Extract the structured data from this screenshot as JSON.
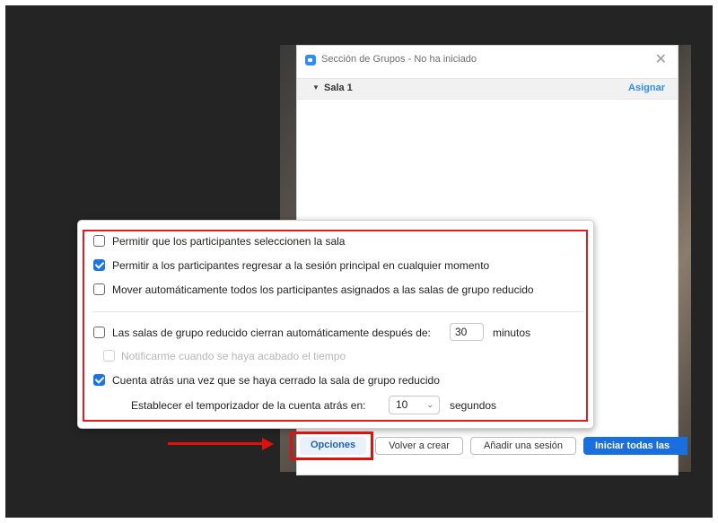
{
  "window": {
    "title": "Sección de Grupos - No ha iniciado",
    "close_glyph": "✕",
    "room_caret": "▼",
    "room_name": "Sala 1",
    "assign_label": "Asignar"
  },
  "options": {
    "items": [
      {
        "label": "Permitir que los participantes seleccionen la sala",
        "checked": false
      },
      {
        "label": "Permitir a los participantes regresar a la sesión principal en cualquier momento",
        "checked": true
      },
      {
        "label": "Mover automáticamente todos los participantes asignados a las salas de grupo reducido",
        "checked": false
      }
    ],
    "auto_close_label": "Las salas de grupo reducido cierran automáticamente después de:",
    "auto_close_checked": false,
    "auto_close_minutes": "30",
    "minutes_unit": "minutos",
    "notify_label": "Notificarme cuando se haya acabado el tiempo",
    "notify_checked": false,
    "countdown_label": "Cuenta atrás una vez que se haya cerrado la sala de grupo reducido",
    "countdown_checked": true,
    "timer_label": "Establecer el temporizador de la cuenta atrás en:",
    "timer_value": "10",
    "timer_caret": "⌄",
    "seconds_unit": "segundos"
  },
  "buttons": {
    "options": "Opciones",
    "recreate": "Volver a crear",
    "add_session": "Añadir una sesión",
    "start_all": "Iniciar todas las"
  },
  "colors": {
    "accent": "#1a73e8",
    "highlight": "#e01010"
  }
}
